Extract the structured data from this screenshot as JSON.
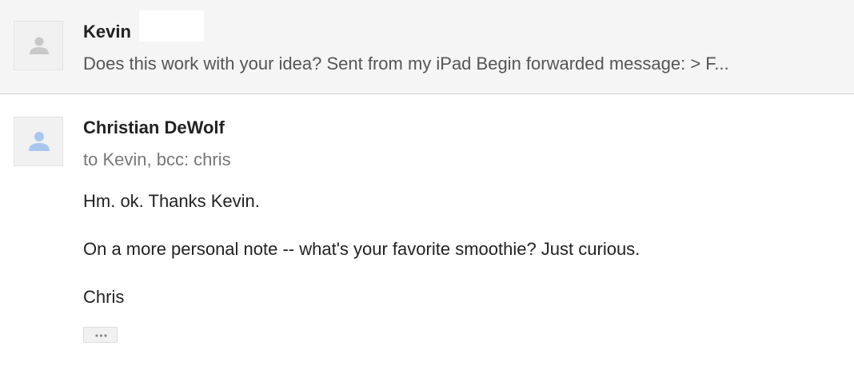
{
  "collapsed_message": {
    "sender": "Kevin",
    "snippet": "Does this work with your idea? Sent from my iPad Begin forwarded message: > F...",
    "avatar_icon": "default-person-icon"
  },
  "expanded_message": {
    "sender": "Christian DeWolf",
    "recipients": "to Kevin, bcc: chris",
    "avatar_icon": "default-person-icon",
    "body": {
      "line_1": "Hm. ok. Thanks Kevin.",
      "line_2": "On a more personal note -- what's your favorite smoothie? Just curious.",
      "line_3": "Chris"
    },
    "show_trimmed_icon": "ellipsis-icon"
  },
  "colors": {
    "collapsed_bg": "#f5f5f5",
    "avatar_gray": "#c8c8c8",
    "avatar_blue": "#a9c6ef"
  }
}
